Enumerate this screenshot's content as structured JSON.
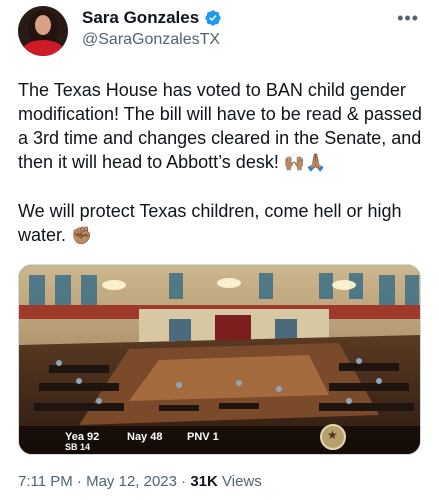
{
  "author": {
    "display_name": "Sara Gonzales",
    "handle": "@SaraGonzalesTX",
    "verified": true
  },
  "tweet": {
    "paragraph1": "The Texas House has voted to BAN child gender modification! The bill will have to be read & passed a 3rd time and changes cleared in the Senate, and then it will head to Abbott’s desk!",
    "paragraph1_emoji": "🙌🏽🙏🏽",
    "paragraph2": "We will protect Texas children, come  hell or high water.",
    "paragraph2_emoji": "✊🏽"
  },
  "media": {
    "yea": "Yea  92",
    "nay": "Nay  48",
    "pnv": "PNV  1",
    "bill": "SB 14"
  },
  "meta": {
    "time": "7:11 PM",
    "separator1": " · ",
    "date": "May 12, 2023",
    "separator2": " · ",
    "views_count": "31K",
    "views_label": " Views"
  },
  "icons": {
    "verified": "verified-badge-icon",
    "more": "more-options-icon"
  },
  "colors": {
    "verified_blue": "#1d9bf0",
    "secondary_text": "#536471",
    "primary_text": "#0f1419"
  }
}
